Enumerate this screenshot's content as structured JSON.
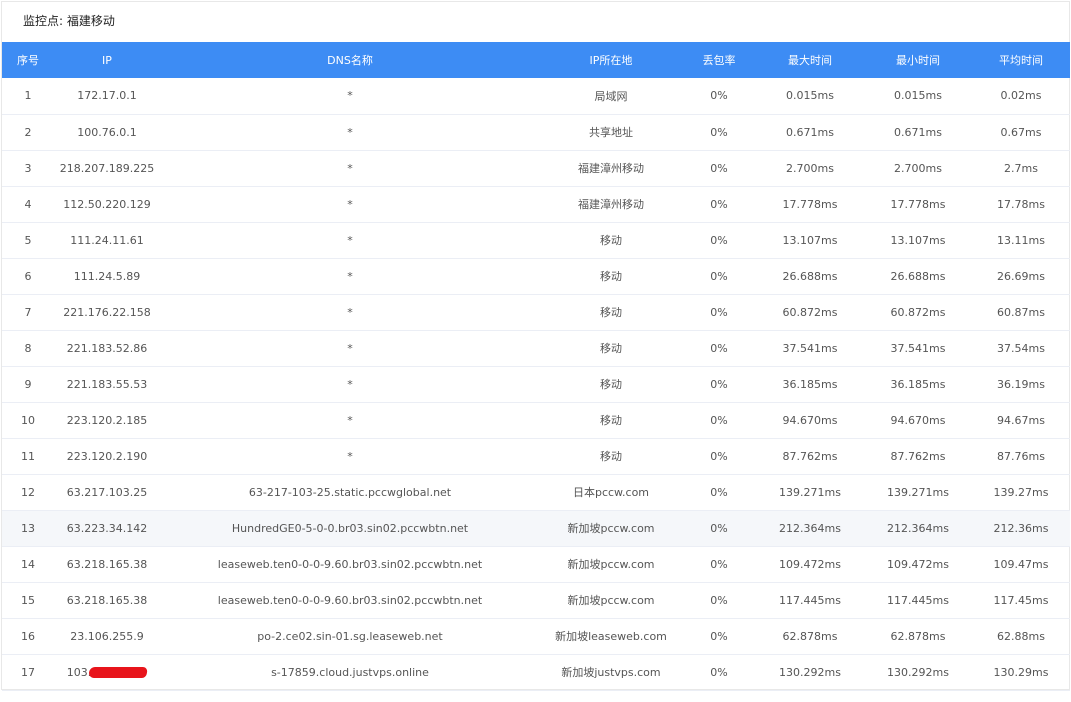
{
  "monitor": {
    "label": "监控点:",
    "value": "福建移动"
  },
  "columns": [
    "序号",
    "IP",
    "DNS名称",
    "IP所在地",
    "丢包率",
    "最大时间",
    "最小时间",
    "平均时间"
  ],
  "rows": [
    [
      "1",
      "172.17.0.1",
      "*",
      "局域网",
      "0%",
      "0.015ms",
      "0.015ms",
      "0.02ms"
    ],
    [
      "2",
      "100.76.0.1",
      "*",
      "共享地址",
      "0%",
      "0.671ms",
      "0.671ms",
      "0.67ms"
    ],
    [
      "3",
      "218.207.189.225",
      "*",
      "福建漳州移动",
      "0%",
      "2.700ms",
      "2.700ms",
      "2.7ms"
    ],
    [
      "4",
      "112.50.220.129",
      "*",
      "福建漳州移动",
      "0%",
      "17.778ms",
      "17.778ms",
      "17.78ms"
    ],
    [
      "5",
      "111.24.11.61",
      "*",
      "移动",
      "0%",
      "13.107ms",
      "13.107ms",
      "13.11ms"
    ],
    [
      "6",
      "111.24.5.89",
      "*",
      "移动",
      "0%",
      "26.688ms",
      "26.688ms",
      "26.69ms"
    ],
    [
      "7",
      "221.176.22.158",
      "*",
      "移动",
      "0%",
      "60.872ms",
      "60.872ms",
      "60.87ms"
    ],
    [
      "8",
      "221.183.52.86",
      "*",
      "移动",
      "0%",
      "37.541ms",
      "37.541ms",
      "37.54ms"
    ],
    [
      "9",
      "221.183.55.53",
      "*",
      "移动",
      "0%",
      "36.185ms",
      "36.185ms",
      "36.19ms"
    ],
    [
      "10",
      "223.120.2.185",
      "*",
      "移动",
      "0%",
      "94.670ms",
      "94.670ms",
      "94.67ms"
    ],
    [
      "11",
      "223.120.2.190",
      "*",
      "移动",
      "0%",
      "87.762ms",
      "87.762ms",
      "87.76ms"
    ],
    [
      "12",
      "63.217.103.25",
      "63-217-103-25.static.pccwglobal.net",
      "日本pccw.com",
      "0%",
      "139.271ms",
      "139.271ms",
      "139.27ms"
    ],
    [
      "13",
      "63.223.34.142",
      "HundredGE0-5-0-0.br03.sin02.pccwbtn.net",
      "新加坡pccw.com",
      "0%",
      "212.364ms",
      "212.364ms",
      "212.36ms"
    ],
    [
      "14",
      "63.218.165.38",
      "leaseweb.ten0-0-0-9.60.br03.sin02.pccwbtn.net",
      "新加坡pccw.com",
      "0%",
      "109.472ms",
      "109.472ms",
      "109.47ms"
    ],
    [
      "15",
      "63.218.165.38",
      "leaseweb.ten0-0-0-9.60.br03.sin02.pccwbtn.net",
      "新加坡pccw.com",
      "0%",
      "117.445ms",
      "117.445ms",
      "117.45ms"
    ],
    [
      "16",
      "23.106.255.9",
      "po-2.ce02.sin-01.sg.leaseweb.net",
      "新加坡leaseweb.com",
      "0%",
      "62.878ms",
      "62.878ms",
      "62.88ms"
    ],
    [
      "17",
      "103.",
      "s-17859.cloud.justvps.online",
      "新加坡justvps.com",
      "0%",
      "130.292ms",
      "130.292ms",
      "130.29ms"
    ]
  ],
  "highlighted_row": 13,
  "redacted_row": 17,
  "colors": {
    "header_bg": "#3d8cf4",
    "header_text": "#ffffff",
    "row_hover_bg": "#f5f7fa",
    "row_border": "#ebeef5",
    "redaction": "#e8141b"
  }
}
